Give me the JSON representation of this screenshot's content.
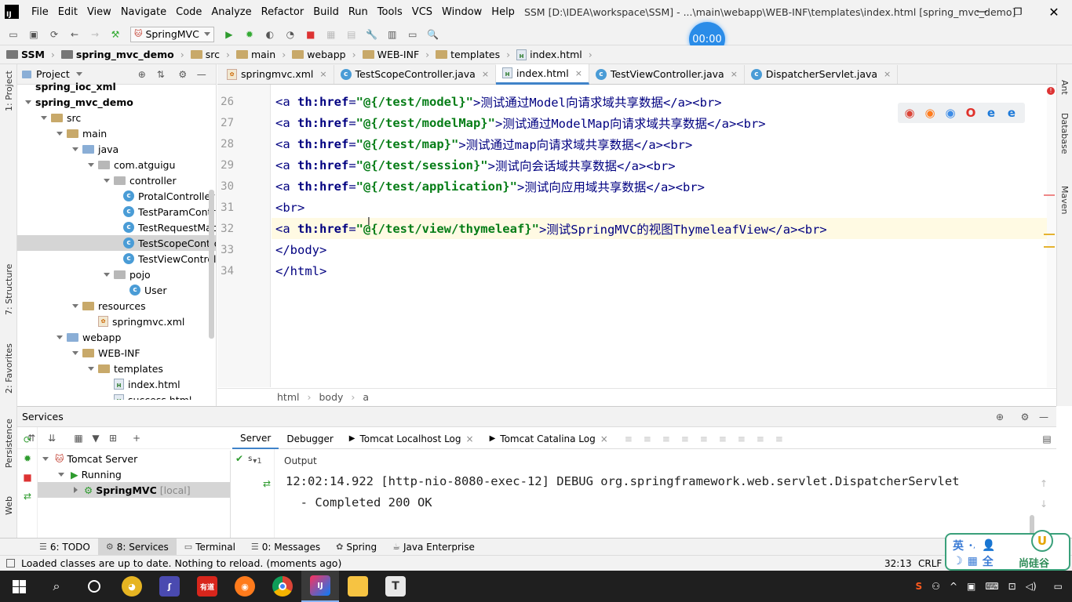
{
  "title_bar": {
    "app_icon": "IJ",
    "menu": [
      "File",
      "Edit",
      "View",
      "Navigate",
      "Code",
      "Analyze",
      "Refactor",
      "Build",
      "Run",
      "Tools",
      "VCS",
      "Window",
      "Help"
    ],
    "window_title": "SSM [D:\\IDEA\\workspace\\SSM] - ...\\main\\webapp\\WEB-INF\\templates\\index.html [spring_mvc_demo]"
  },
  "toolbar": {
    "run_config": "SpringMVC",
    "timer": "00:00"
  },
  "breadcrumb": [
    "SSM",
    "spring_mvc_demo",
    "src",
    "main",
    "webapp",
    "WEB-INF",
    "templates",
    "index.html"
  ],
  "project_panel": {
    "title": "Project",
    "tree": [
      {
        "label": "spring_ioc_xml",
        "kind": "module"
      },
      {
        "label": "spring_mvc_demo",
        "kind": "module"
      },
      {
        "label": "src",
        "kind": "folder"
      },
      {
        "label": "main",
        "kind": "folder"
      },
      {
        "label": "java",
        "kind": "folder-blue"
      },
      {
        "label": "com.atguigu",
        "kind": "package"
      },
      {
        "label": "controller",
        "kind": "package"
      },
      {
        "label": "ProtalController",
        "kind": "class"
      },
      {
        "label": "TestParamController",
        "kind": "class"
      },
      {
        "label": "TestRequestMapping",
        "kind": "class"
      },
      {
        "label": "TestScopeController",
        "kind": "class"
      },
      {
        "label": "TestViewController",
        "kind": "class"
      },
      {
        "label": "pojo",
        "kind": "package"
      },
      {
        "label": "User",
        "kind": "class"
      },
      {
        "label": "resources",
        "kind": "folder"
      },
      {
        "label": "springmvc.xml",
        "kind": "xml"
      },
      {
        "label": "webapp",
        "kind": "folder-blue"
      },
      {
        "label": "WEB-INF",
        "kind": "folder"
      },
      {
        "label": "templates",
        "kind": "folder"
      },
      {
        "label": "index.html",
        "kind": "html"
      },
      {
        "label": "success.html",
        "kind": "html"
      }
    ]
  },
  "editor_tabs": [
    {
      "label": "springmvc.xml",
      "kind": "xml"
    },
    {
      "label": "TestScopeController.java",
      "kind": "class"
    },
    {
      "label": "index.html",
      "kind": "html",
      "active": true
    },
    {
      "label": "TestViewController.java",
      "kind": "class"
    },
    {
      "label": "DispatcherServlet.java",
      "kind": "class"
    }
  ],
  "code_lines": [
    {
      "num": "26",
      "before": "<a ",
      "attr": "th:href",
      "eq": "=",
      "val": "\"@{/test/model}\"",
      "after": ">测试通过Model向请求域共享数据</a><br>"
    },
    {
      "num": "27",
      "before": "<a ",
      "attr": "th:href",
      "eq": "=",
      "val": "\"@{/test/modelMap}\"",
      "after": ">测试通过ModelMap向请求域共享数据</a><br>"
    },
    {
      "num": "28",
      "before": "<a ",
      "attr": "th:href",
      "eq": "=",
      "val": "\"@{/test/map}\"",
      "after": ">测试通过map向请求域共享数据</a><br>"
    },
    {
      "num": "29",
      "before": "<a ",
      "attr": "th:href",
      "eq": "=",
      "val": "\"@{/test/session}\"",
      "after": ">测试向会话域共享数据</a><br>"
    },
    {
      "num": "30",
      "before": "<a ",
      "attr": "th:href",
      "eq": "=",
      "val": "\"@{/test/application}\"",
      "after": ">测试向应用域共享数据</a><br>"
    },
    {
      "num": "31",
      "before": "<br>",
      "attr": "",
      "eq": "",
      "val": "",
      "after": ""
    },
    {
      "num": "32",
      "before": "<a ",
      "attr": "th:href",
      "eq": "=",
      "val": "\"@{/test/view/thymeleaf}\"",
      "after": ">测试SpringMVC的视图ThymeleafView</a><br>"
    },
    {
      "num": "33",
      "before": "</body>",
      "attr": "",
      "eq": "",
      "val": "",
      "after": ""
    },
    {
      "num": "34",
      "before": "</html>",
      "attr": "",
      "eq": "",
      "val": "",
      "after": ""
    }
  ],
  "editor_breadcrumb": [
    "html",
    "body",
    "a"
  ],
  "browser_icons": [
    "chrome-icon",
    "firefox-icon",
    "safari-icon",
    "opera-icon",
    "ie-icon",
    "edge-icon"
  ],
  "services": {
    "title": "Services",
    "tree": [
      {
        "label": "Tomcat Server"
      },
      {
        "label": "Running"
      },
      {
        "label": "SpringMVC",
        "suffix": "[local]"
      }
    ],
    "tabs": [
      "Server",
      "Debugger",
      "Tomcat Localhost Log",
      "Tomcat Catalina Log"
    ],
    "output_label": "Output",
    "output_lines": [
      "12:02:14.922 [http-nio-8080-exec-12] DEBUG org.springframework.web.servlet.DispatcherServlet",
      "  - Completed 200 OK"
    ]
  },
  "left_strip": [
    "1: Project",
    "7: Structure",
    "2: Favorites",
    "Persistence",
    "Web"
  ],
  "right_strip": [
    "Ant",
    "Database",
    "Maven"
  ],
  "bottom_tabs": [
    {
      "label": "6: TODO",
      "icon": "todo-icon"
    },
    {
      "label": "8: Services",
      "icon": "services-icon",
      "active": true
    },
    {
      "label": "Terminal",
      "icon": "terminal-icon"
    },
    {
      "label": "0: Messages",
      "icon": "messages-icon"
    },
    {
      "label": "Spring",
      "icon": "spring-icon"
    },
    {
      "label": "Java Enterprise",
      "icon": "java-enterprise-icon"
    }
  ],
  "status_bar": {
    "message": "Loaded classes are up to date. Nothing to reload. (moments ago)",
    "position": "32:13",
    "line_sep": "CRLF"
  },
  "ime_widget": {
    "lang": "英",
    "mode": "全",
    "brand": "尚硅谷"
  },
  "taskbar": {
    "apps": [
      "windows-icon",
      "search-icon",
      "cortana-icon",
      "app-icon-1",
      "app-icon-2",
      "youdao-icon",
      "firefox-icon",
      "chrome-icon",
      "intellij-icon",
      "explorer-icon",
      "typora-icon"
    ],
    "youdao_label": "有道",
    "typora_label": "T"
  },
  "colors": {
    "accent": "#3875d7",
    "editor_caret_line": "#fffae3",
    "selection": "#d5d5d5",
    "tomcat_red": "#c0392b"
  }
}
